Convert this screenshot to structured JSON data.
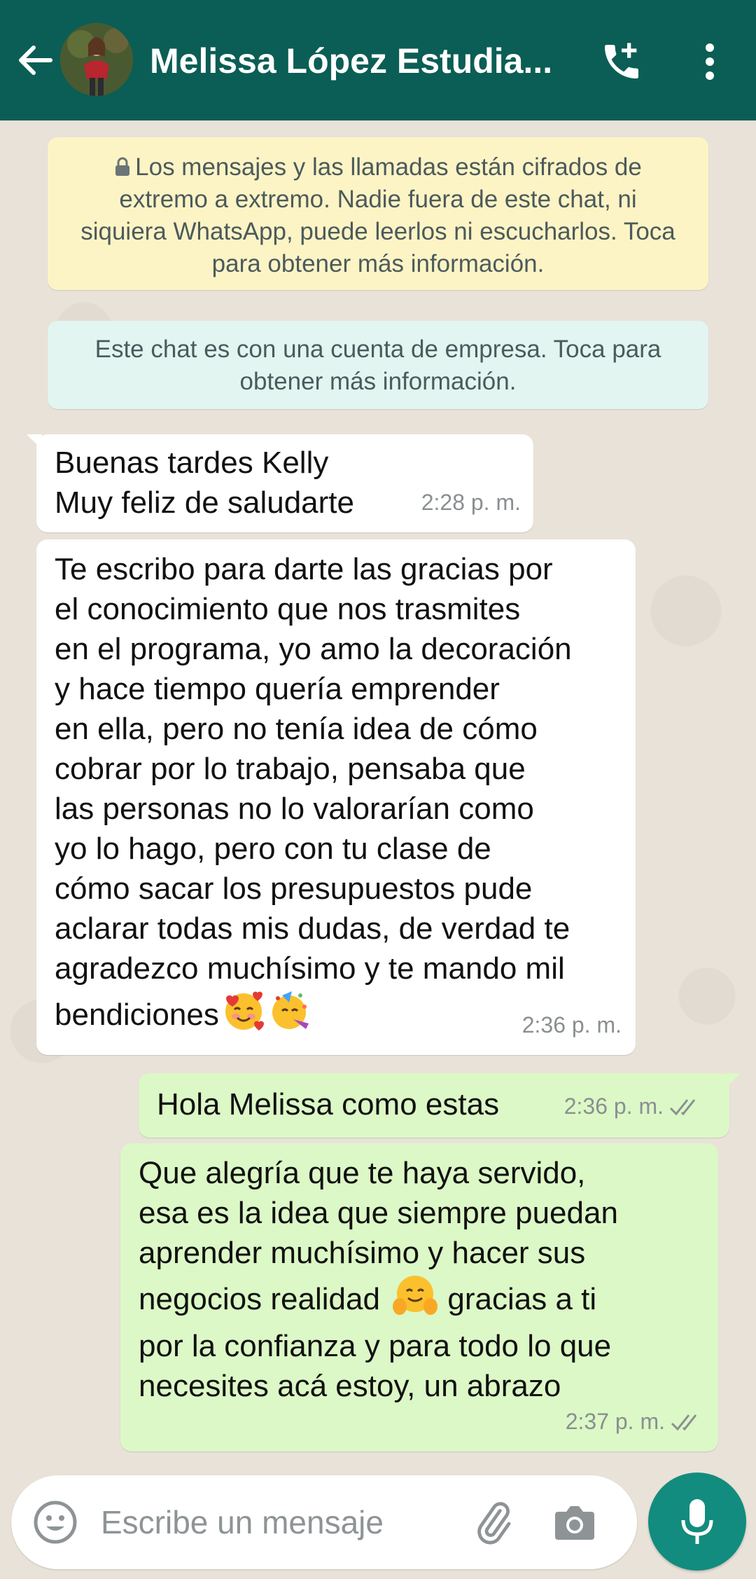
{
  "header": {
    "title": "Melissa López Estudia...",
    "back_icon": "arrow-left-icon",
    "call_icon": "add-call-icon",
    "menu_icon": "more-vert-icon",
    "color": "#0b5e55"
  },
  "notices": {
    "encryption": "Los mensajes y las llamadas están cifrados de extremo a extremo. Nadie fuera de este chat, ni siquiera WhatsApp, puede leerlos ni escucharlos. Toca para obtener más información.",
    "business": "Este chat es con una cuenta de empresa. Toca para obtener más información."
  },
  "messages": [
    {
      "direction": "incoming",
      "text": "Buenas tardes Kelly\nMuy feliz de saludarte",
      "time": "2:28 p. m."
    },
    {
      "direction": "incoming",
      "text": "Te escribo para darte las gracias por\nel conocimiento que nos trasmites\nen el programa, yo amo la decoración\ny hace tiempo quería emprender\nen ella, pero no tenía idea de cómo\ncobrar por lo trabajo, pensaba que\nlas personas no lo valorarían como\nyo lo hago, pero con tu clase de\ncómo sacar los presupuestos pude\naclarar todas mis dudas, de verdad te\nagradezco muchísimo y te mando mil\nbendiciones",
      "emojis": [
        "smiling-face-with-hearts",
        "partying-face"
      ],
      "time": "2:36 p. m."
    },
    {
      "direction": "outgoing",
      "text": "Hola Melissa como estas",
      "time": "2:36 p. m.",
      "status": "read"
    },
    {
      "direction": "outgoing",
      "text_before": "Que alegría que te haya servido,\nesa es la idea que siempre puedan\naprender muchísimo y hacer sus\nnegocios realidad",
      "emoji": "hugging-face",
      "text_after": "gracias a ti\npor la confianza y para todo lo que\nnecesites acá estoy, un abrazo",
      "time": "2:37 p. m.",
      "status": "read"
    }
  ],
  "composer": {
    "placeholder": "Escribe un mensaje",
    "emoji_icon": "emoji-icon",
    "attach_icon": "paperclip-icon",
    "camera_icon": "camera-icon",
    "mic_icon": "microphone-icon",
    "mic_color": "#128c7e"
  },
  "colors": {
    "incoming_bubble": "#ffffff",
    "outgoing_bubble": "#dcf8c6",
    "encryption_notice": "#fdf4c5",
    "business_notice": "#e2f5f1",
    "wallpaper": "#e9e2d9"
  }
}
